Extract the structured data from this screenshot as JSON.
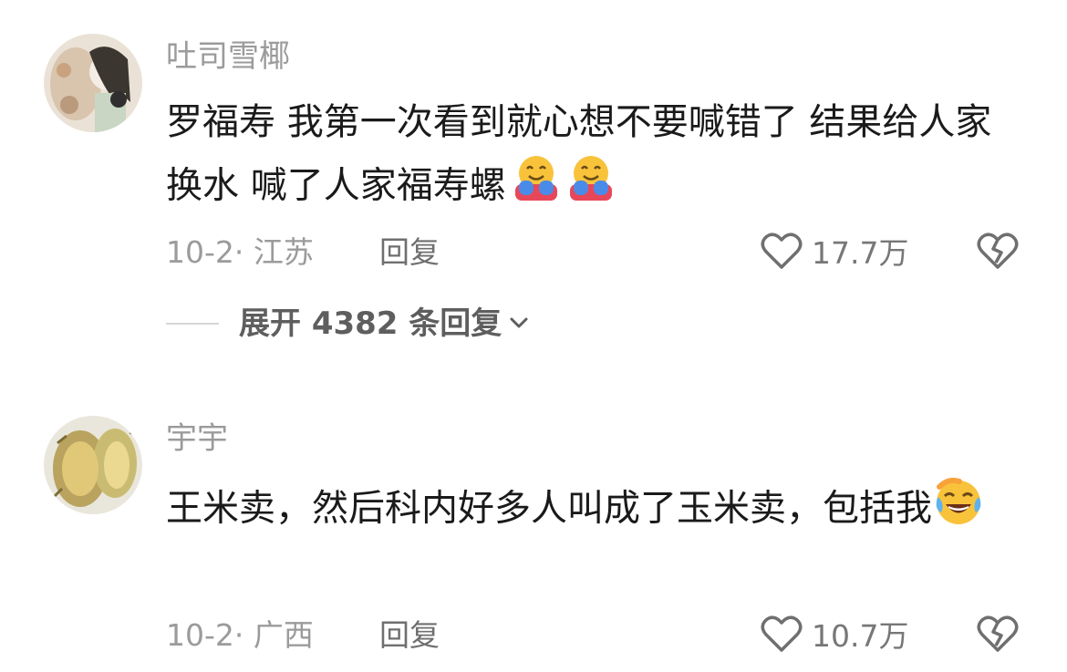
{
  "comments": [
    {
      "username": "吐司雪椰",
      "text": "罗福寿 我第一次看到就心想不要喊错了 结果给人家换水 喊了人家福寿螺",
      "emoji_icons": [
        "hugging-face-icon",
        "hugging-face-icon"
      ],
      "date_location": "10-2· 江苏",
      "reply_label": "回复",
      "like_count": "17.7万",
      "expand_replies": "展开 4382 条回复"
    },
    {
      "username": "宇宇",
      "text": "王米卖，然后科内好多人叫成了玉米卖，包括我",
      "emoji_icons": [
        "crying-laughing-icon"
      ],
      "date_location": "10-2· 广西",
      "reply_label": "回复",
      "like_count": "10.7万"
    }
  ],
  "colors": {
    "username": "#9b9b9b",
    "text": "#1a1a1a",
    "meta": "#9b9b9b",
    "icon": "#7a7a7a"
  }
}
